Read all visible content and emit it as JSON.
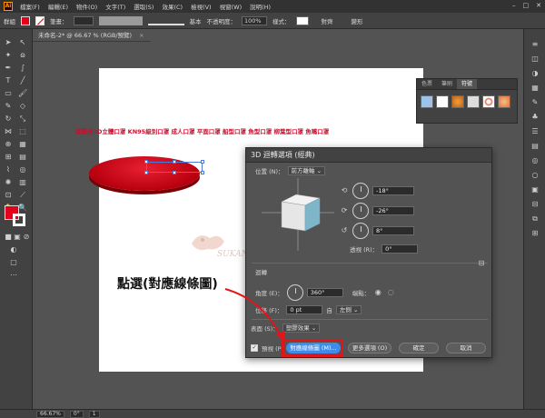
{
  "menubar": {
    "logo": "Ai",
    "items": [
      "檔案(F)",
      "編輯(E)",
      "物件(O)",
      "文字(T)",
      "選取(S)",
      "效果(C)",
      "檢視(V)",
      "視窗(W)",
      "說明(H)"
    ]
  },
  "controlbar": {
    "selection_label": "群組",
    "stroke_label": "筆畫：",
    "stroke_style": "基本",
    "opacity_label": "不透明度：",
    "opacity_value": "100%",
    "style_label": "樣式：",
    "align_label": "對齊",
    "transform_label": "變形"
  },
  "document": {
    "tab_title": "未命名-2* @ 66.67 % (RGB/預覽)",
    "close": "×",
    "headline": "莫蘭迪4D立體口罩 KN95級別口罩 成人口罩 平面口罩 船型口罩 魚型口罩 柳葉型口罩 魚嘴口罩",
    "watermark": "SUKANA"
  },
  "panel": {
    "tabs": [
      "色票",
      "筆刷",
      "符號"
    ],
    "active_tab": "符號"
  },
  "annotation": {
    "text": "點選(對應線條圖)"
  },
  "dialog": {
    "title": "3D 迴轉選項 (經典)",
    "position_label": "位置 (N)：",
    "position_value": "前方離軸",
    "x_rotation": "-18°",
    "y_rotation": "-26°",
    "z_rotation": "8°",
    "perspective_label": "透視 (R)：",
    "perspective_value": "0°",
    "revolve_section": "迴轉",
    "angle_label": "角度 (E)：",
    "angle_value": "360°",
    "cap_label": "端點：",
    "offset_label": "位移 (F)：",
    "offset_value": "0 pt",
    "offset_from_label": "自",
    "offset_from_value": "左側",
    "surface_label": "表面 (S)：",
    "surface_value": "塑膠效果",
    "preview_label": "預視 (P)",
    "map_art_button": "對應線條圖 (M)...",
    "more_options_button": "更多選項 (O)",
    "ok_button": "確定",
    "cancel_button": "取消"
  },
  "statusbar": {
    "zoom": "66.67%",
    "rotation": "0°",
    "artboard": "1"
  },
  "colors": {
    "accent": "#3f8be8",
    "highlight": "#e0151a",
    "headline": "#c8102e",
    "object_fill": "#c8000f",
    "cube_front": "#7fb5c9",
    "cube_side": "#e6e6e6"
  }
}
